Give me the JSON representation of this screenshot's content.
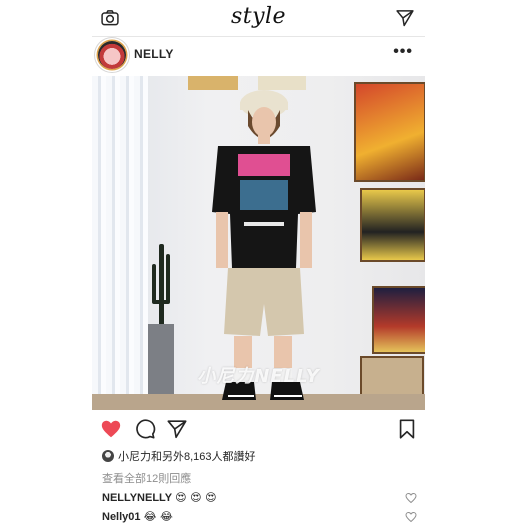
{
  "app": {
    "logo": "style"
  },
  "post": {
    "username": "NELLY",
    "more_label": "•••",
    "watermark": "小尼力NELLY",
    "likes_text": "小尼力和另外8,163人都讚好",
    "view_all_comments": "查看全部12則回應",
    "comments": [
      {
        "author": "NELLYNELLY",
        "text": "😍 😍 😍"
      },
      {
        "author": "Nelly01",
        "text": "😂 😂"
      }
    ]
  },
  "icons": {
    "camera": "camera-icon",
    "direct": "send-icon",
    "like": "heart-icon",
    "comment": "comment-icon",
    "share": "share-icon",
    "save": "bookmark-icon"
  },
  "colors": {
    "like": "#ed4956",
    "text": "#262626",
    "muted": "#8e8e8e"
  }
}
